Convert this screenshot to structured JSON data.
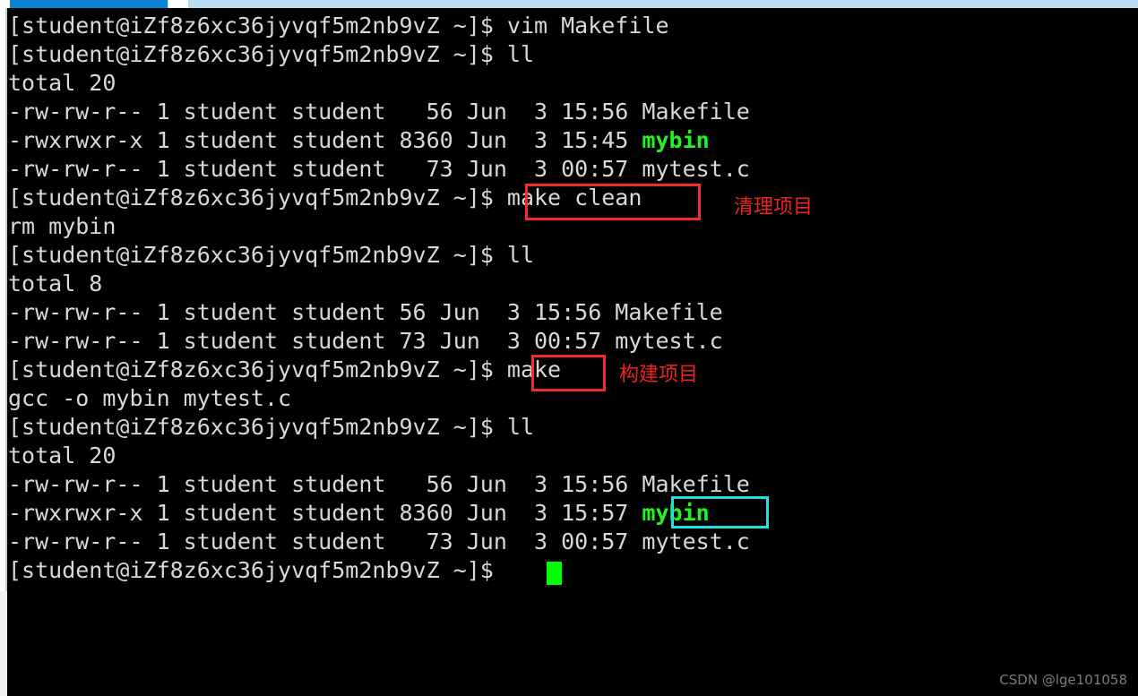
{
  "window": {
    "background_color": "#000000",
    "foreground_color": "#d8d8d8",
    "accent_green": "#21f521",
    "cursor_color": "#00ff00",
    "highlight_red": "#f42b2b",
    "highlight_cyan": "#1fe0e0",
    "scrollbar_blue": "#0a84d6"
  },
  "terminal": {
    "prompt": "[student@iZf8z6xc36jyvqf5m2nb9vZ ~]$ ",
    "lines": [
      {
        "id": "l01",
        "text": "[student@iZf8z6xc36jyvqf5m2nb9vZ ~]$ vim Makefile"
      },
      {
        "id": "l02",
        "text": "[student@iZf8z6xc36jyvqf5m2nb9vZ ~]$ ll"
      },
      {
        "id": "l03",
        "text": "total 20"
      },
      {
        "id": "l04",
        "text": "-rw-rw-r-- 1 student student   56 Jun  3 15:56 Makefile"
      },
      {
        "id": "l05a",
        "text": "-rwxrwxr-x 1 student student 8360 Jun  3 15:45 "
      },
      {
        "id": "l05b",
        "text": "mybin"
      },
      {
        "id": "l06",
        "text": "-rw-rw-r-- 1 student student   73 Jun  3 00:57 mytest.c"
      },
      {
        "id": "l07",
        "text": "[student@iZf8z6xc36jyvqf5m2nb9vZ ~]$ make clean"
      },
      {
        "id": "l08",
        "text": "rm mybin"
      },
      {
        "id": "l09",
        "text": "[student@iZf8z6xc36jyvqf5m2nb9vZ ~]$ ll"
      },
      {
        "id": "l10",
        "text": "total 8"
      },
      {
        "id": "l11",
        "text": "-rw-rw-r-- 1 student student 56 Jun  3 15:56 Makefile"
      },
      {
        "id": "l12",
        "text": "-rw-rw-r-- 1 student student 73 Jun  3 00:57 mytest.c"
      },
      {
        "id": "l13",
        "text": "[student@iZf8z6xc36jyvqf5m2nb9vZ ~]$ make"
      },
      {
        "id": "l14",
        "text": "gcc -o mybin mytest.c"
      },
      {
        "id": "l15",
        "text": "[student@iZf8z6xc36jyvqf5m2nb9vZ ~]$ ll"
      },
      {
        "id": "l16",
        "text": "total 20"
      },
      {
        "id": "l17",
        "text": "-rw-rw-r-- 1 student student   56 Jun  3 15:56 Makefile"
      },
      {
        "id": "l18a",
        "text": "-rwxrwxr-x 1 student student 8360 Jun  3 15:57 "
      },
      {
        "id": "l18b",
        "text": "mybin"
      },
      {
        "id": "l19",
        "text": "-rw-rw-r-- 1 student student   73 Jun  3 00:57 mytest.c"
      },
      {
        "id": "l20",
        "text": "[student@iZf8z6xc36jyvqf5m2nb9vZ ~]$ "
      }
    ]
  },
  "annotations": [
    {
      "id": "a1",
      "text": "清理项目",
      "target": "make clean"
    },
    {
      "id": "a2",
      "text": "构建项目",
      "target": "make"
    }
  ],
  "highlights": [
    {
      "id": "h1",
      "label": "make clean",
      "color": "#f42b2b"
    },
    {
      "id": "h2",
      "label": "make",
      "color": "#f42b2b"
    },
    {
      "id": "h3",
      "label": "mybin",
      "color": "#1fe0e0"
    }
  ],
  "watermark": {
    "text": "CSDN @lge101058"
  }
}
